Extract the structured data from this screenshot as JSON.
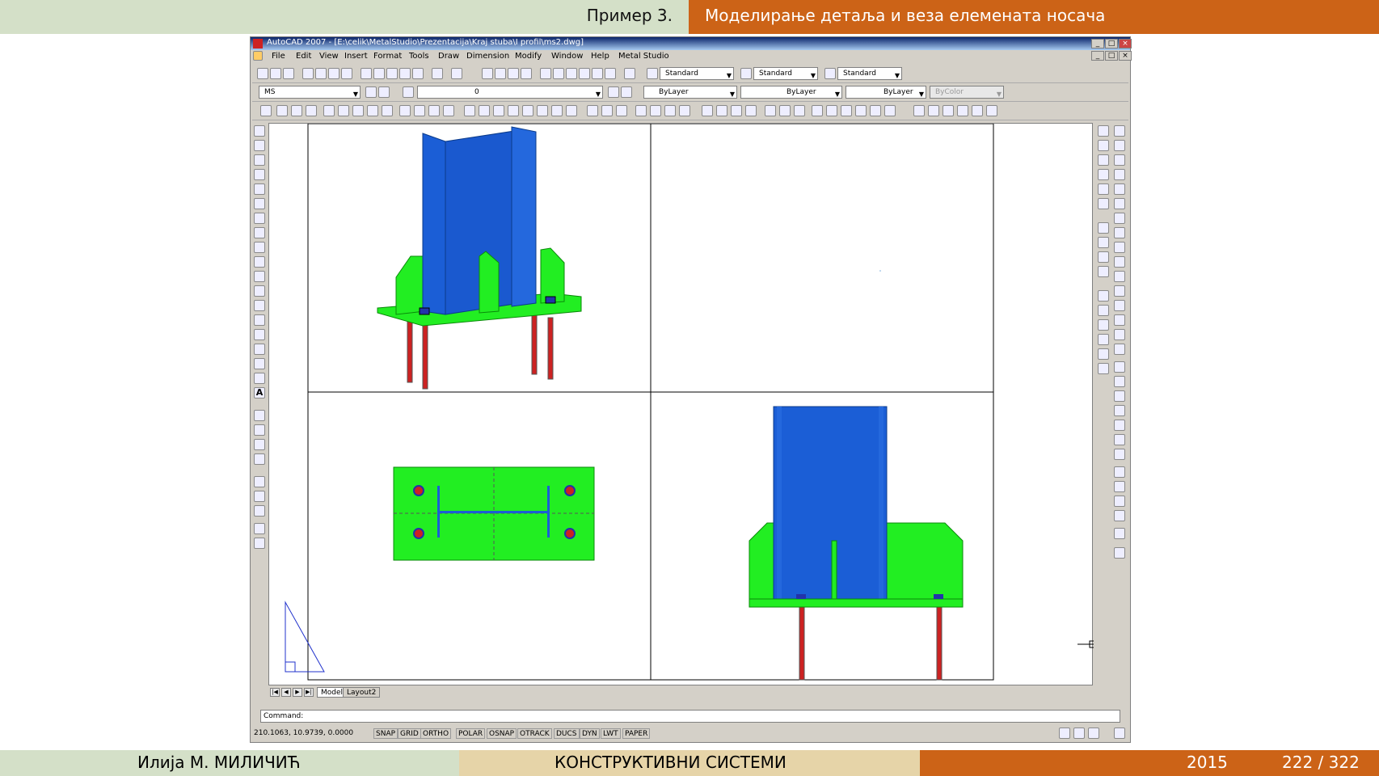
{
  "slide": {
    "header_left": "Пример 3.",
    "header_right": "Моделирање детаља и веза елемената носача",
    "footer_author": "Илија М. МИЛИЧИЋ",
    "footer_course": "КОНСТРУКТИВНИ СИСТЕМИ",
    "footer_year": "2015",
    "footer_page": "222 / 322",
    "colors": {
      "green": "#d4e0c8",
      "orange": "#cc6317",
      "tan": "#e6d4a8"
    }
  },
  "window": {
    "title": "AutoCAD 2007 - [E:\\celik\\MetalStudio\\Prezentacija\\Kraj stuba\\I profil\\ms2.dwg]",
    "buttons": [
      "minimize",
      "restore",
      "close"
    ]
  },
  "menu": [
    "File",
    "Edit",
    "View",
    "Insert",
    "Format",
    "Tools",
    "Draw",
    "Dimension",
    "Modify",
    "Window",
    "Help",
    "Metal Studio"
  ],
  "toolbar": {
    "text_style": "Standard",
    "dim_style": "Standard",
    "table_style": "Standard",
    "workspace": "MS",
    "layer": "0",
    "color": "ByLayer",
    "linetype": "ByLayer",
    "lineweight": "ByLayer",
    "plotstyle": "ByColor"
  },
  "layout_tabs": [
    "Model",
    "Layout2"
  ],
  "command": {
    "label": "Command:"
  },
  "status": {
    "coordinates": "210.1063, 10.9739, 0.0000",
    "toggles": [
      "SNAP",
      "GRID",
      "ORTHO",
      "POLAR",
      "OSNAP",
      "OTRACK",
      "DUCS",
      "DYN",
      "LWT",
      "PAPER"
    ]
  },
  "drawing_colors": {
    "column": "#1b5ed6",
    "plate": "#22ee22",
    "bolt": "#cc2222",
    "bolt_head": "#2233aa",
    "lines": "#000000"
  }
}
